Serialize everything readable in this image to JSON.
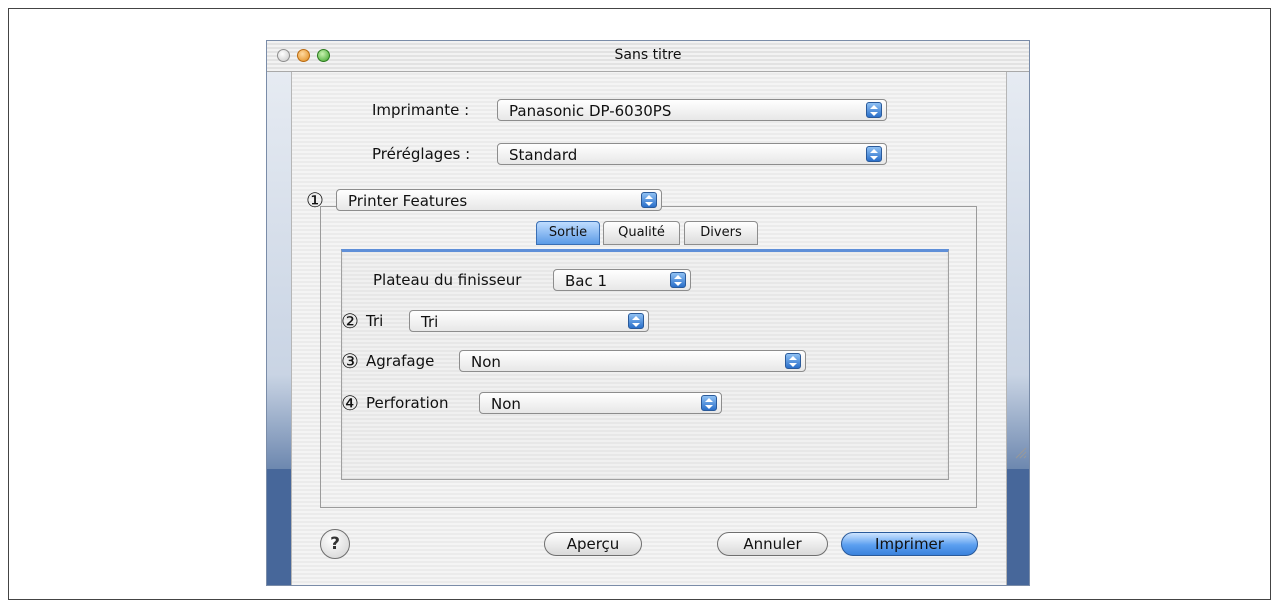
{
  "window": {
    "title": "Sans titre"
  },
  "printer": {
    "label": "Imprimante :",
    "value": "Panasonic DP-6030PS"
  },
  "presets": {
    "label": "Préréglages :",
    "value": "Standard"
  },
  "panel_select": {
    "marker": "①",
    "value": "Printer Features"
  },
  "tabs": [
    {
      "label": "Sortie",
      "selected": true
    },
    {
      "label": "Qualité",
      "selected": false
    },
    {
      "label": "Divers",
      "selected": false
    }
  ],
  "options": {
    "finisher_tray": {
      "label": "Plateau du finisseur",
      "value": "Bac 1"
    },
    "sort": {
      "marker": "②",
      "label": "Tri",
      "value": "Tri"
    },
    "staple": {
      "marker": "③",
      "label": "Agrafage",
      "value": "Non"
    },
    "punch": {
      "marker": "④",
      "label": "Perforation",
      "value": "Non"
    }
  },
  "buttons": {
    "help": "?",
    "preview": "Aperçu",
    "cancel": "Annuler",
    "print": "Imprimer"
  },
  "icons": {
    "popup_arrow": "updown-arrows-icon",
    "resize": "resize-grip-icon"
  }
}
